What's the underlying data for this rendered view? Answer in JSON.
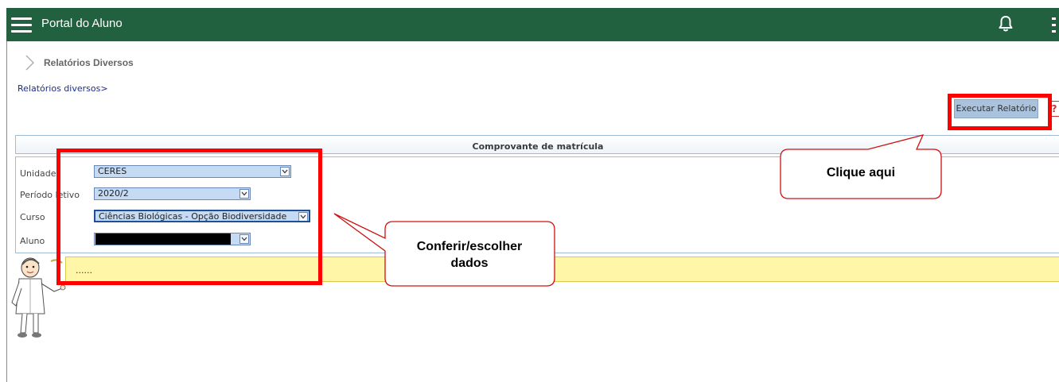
{
  "header": {
    "app_title": "Portal do Aluno",
    "bg_color": "#226140",
    "menu_icon": "hamburger-icon",
    "notification_icon": "bell-icon",
    "more_icon": "kebab-menu-icon"
  },
  "breadcrumb": {
    "title": "Relatórios Diversos",
    "link": "Relatórios diversos>"
  },
  "toolbar": {
    "run_label": "Executar Relatório",
    "help_glyph": "?"
  },
  "form": {
    "title": "Comprovante de matrícula",
    "fields": [
      {
        "label": "Unidade",
        "value": "CERES"
      },
      {
        "label": "Período letivo",
        "value": "2020/2"
      },
      {
        "label": "Curso",
        "value": "Ciências Biológicas - Opção Biodiversidade"
      },
      {
        "label": "Aluno",
        "value": ""
      }
    ]
  },
  "message": {
    "text": "......"
  },
  "annotations": {
    "callout_run": "Clique aqui",
    "callout_fields": "Conferir/escolher dados",
    "highlight_color": "#ff0000"
  }
}
